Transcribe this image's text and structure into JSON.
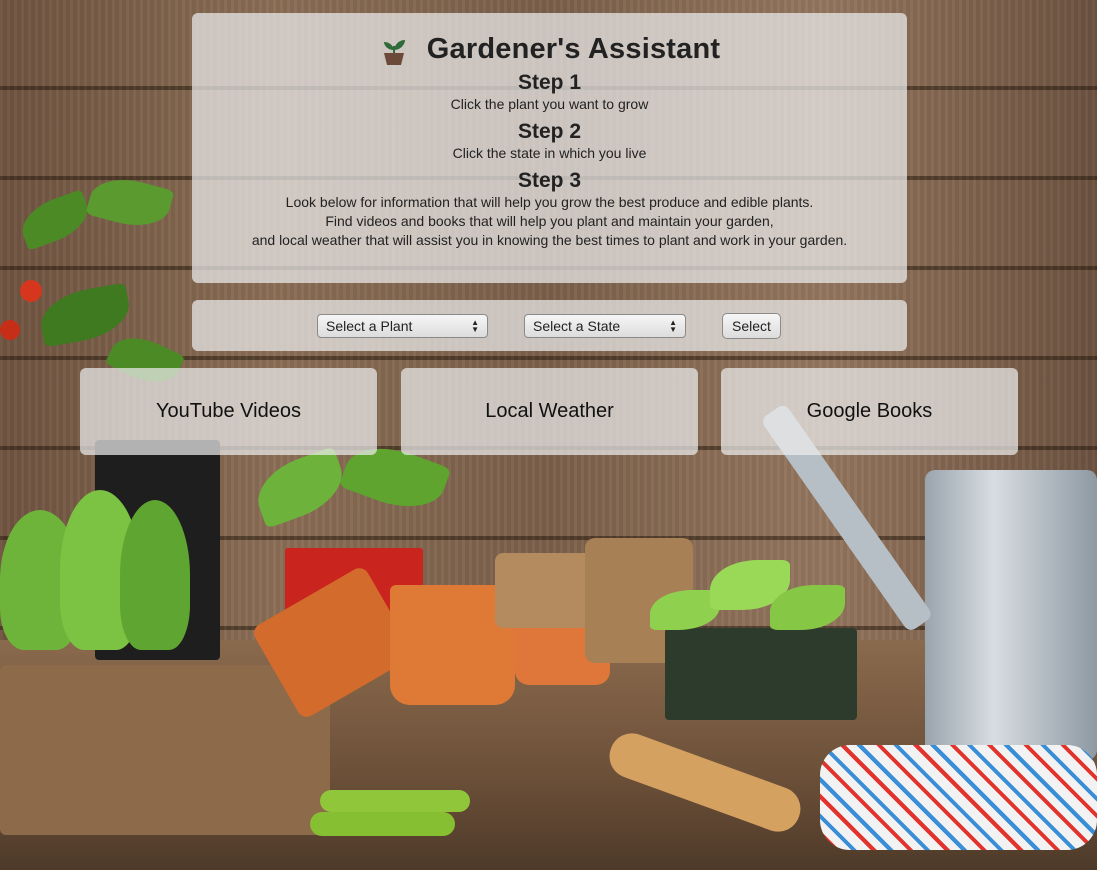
{
  "app": {
    "title": "Gardener's Assistant",
    "icon": "sprout-pot-icon"
  },
  "steps": [
    {
      "heading": "Step 1",
      "lines": [
        "Click the plant you want to grow"
      ]
    },
    {
      "heading": "Step 2",
      "lines": [
        "Click the state in which you live"
      ]
    },
    {
      "heading": "Step 3",
      "lines": [
        "Look below for information that will help you grow the best produce and edible plants.",
        "Find videos and books that will help you plant and maintain your garden,",
        "and local weather that will assist you in knowing the best times to plant and work in your garden."
      ]
    }
  ],
  "controls": {
    "plant_select": "Select a Plant",
    "state_select": "Select a State",
    "submit_label": "Select"
  },
  "cards": [
    {
      "label": "YouTube Videos"
    },
    {
      "label": "Local Weather"
    },
    {
      "label": "Google Books"
    }
  ],
  "colors": {
    "panel": "#ebebeb",
    "text": "#222222",
    "leaf": "#5aa02c",
    "pot": "#6b4a3a"
  }
}
